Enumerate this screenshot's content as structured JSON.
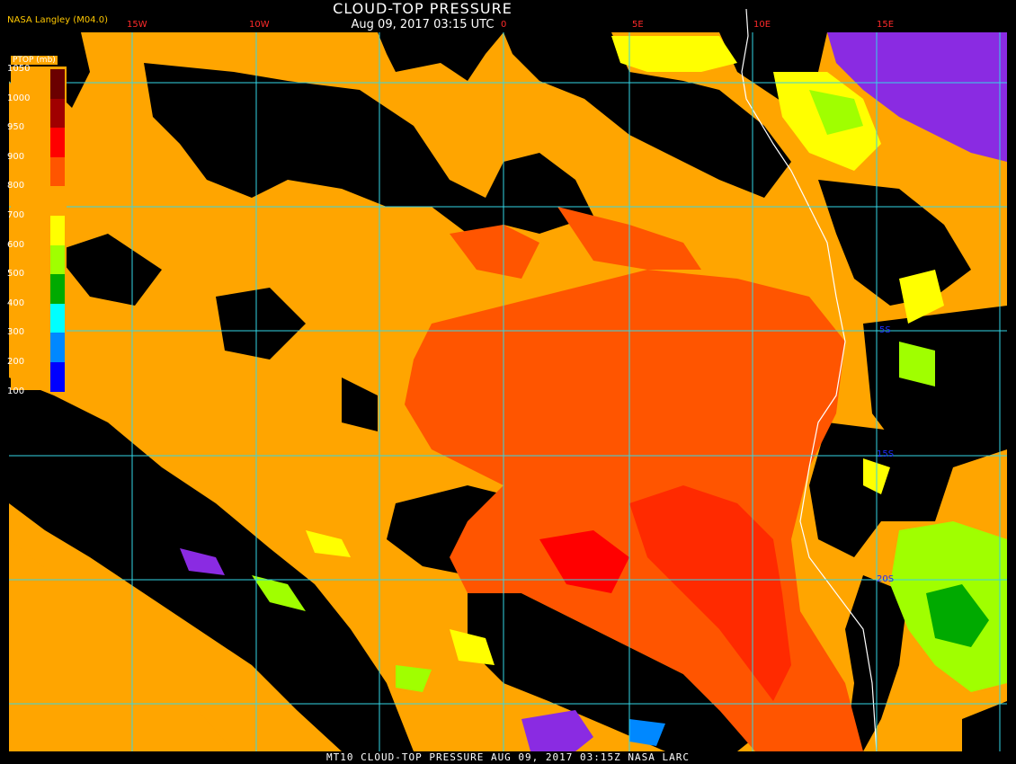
{
  "header": {
    "title": "CLOUD-TOP PRESSURE",
    "datetime": "Aug 09, 2017 03:15 UTC",
    "organization": "NASA Langley (M04.0)"
  },
  "legend": {
    "title": "PTOP (mb)",
    "ticks": [
      "1050",
      "1000",
      "950",
      "900",
      "800",
      "700",
      "600",
      "500",
      "400",
      "300",
      "200",
      "100"
    ],
    "colors": [
      "#6b0000",
      "#a00000",
      "#ff0000",
      "#ff5500",
      "#ffa500",
      "#ffff00",
      "#a0ff00",
      "#00aa00",
      "#00ffff",
      "#0088ff",
      "#0000ff",
      "#8a2be2"
    ]
  },
  "grid": {
    "longitude_labels": [
      "15W",
      "10W",
      "0",
      "5E",
      "10E",
      "15E"
    ],
    "latitude_labels": [
      "5S",
      "15S",
      "20S"
    ],
    "line_color": "#33d6e6"
  },
  "footer": {
    "text": "MT10  CLOUD-TOP PRESSURE   AUG 09, 2017 03:15Z   NASA LARC"
  }
}
